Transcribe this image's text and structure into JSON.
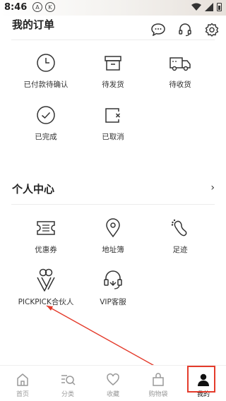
{
  "status_bar": {
    "time": "8:46",
    "icons": [
      "notification-a-icon",
      "notification-k-icon",
      "wifi-icon",
      "signal-icon",
      "battery-icon"
    ]
  },
  "header": {
    "title": "我的订单",
    "icons": [
      "chat-icon",
      "headset-icon",
      "settings-icon"
    ]
  },
  "orders": [
    {
      "label": "已付款待确认",
      "icon": "clock-icon"
    },
    {
      "label": "待发货",
      "icon": "box-icon"
    },
    {
      "label": "待收货",
      "icon": "truck-icon"
    },
    {
      "label": "已完成",
      "icon": "check-circle-icon"
    },
    {
      "label": "已取消",
      "icon": "cancel-icon"
    }
  ],
  "personal": {
    "title": "个人中心",
    "items": [
      {
        "label": "优惠券",
        "icon": "coupon-icon"
      },
      {
        "label": "地址簿",
        "icon": "location-pin-icon"
      },
      {
        "label": "足迹",
        "icon": "footprint-icon"
      },
      {
        "label": "PICKPICK合伙人",
        "icon": "partner-logo-icon"
      },
      {
        "label": "VIP客服",
        "icon": "vip-service-icon"
      }
    ]
  },
  "tabs": [
    {
      "label": "首页",
      "icon": "home-icon",
      "active": false
    },
    {
      "label": "分类",
      "icon": "category-search-icon",
      "active": false
    },
    {
      "label": "收藏",
      "icon": "heart-icon",
      "active": false
    },
    {
      "label": "购物袋",
      "icon": "shopping-bag-icon",
      "active": false
    },
    {
      "label": "我的",
      "icon": "user-icon",
      "active": true
    }
  ],
  "annotation": {
    "color": "#e43b2b"
  }
}
